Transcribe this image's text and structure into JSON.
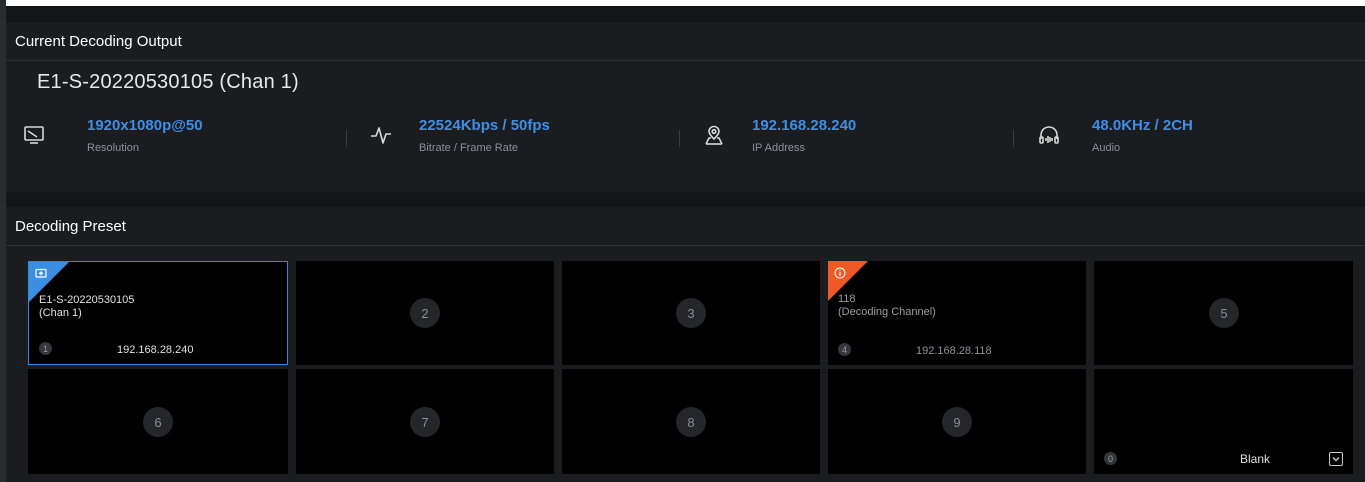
{
  "output": {
    "title": "Current Decoding Output",
    "source_name": "E1-S-20220530105 (Chan 1)",
    "stats": [
      {
        "icon": "monitor-icon",
        "value": "1920x1080p@50",
        "label": "Resolution"
      },
      {
        "icon": "waveform-icon",
        "value": "22524Kbps / 50fps",
        "label": "Bitrate / Frame Rate"
      },
      {
        "icon": "location-pin-icon",
        "value": "192.168.28.240",
        "label": "IP Address"
      },
      {
        "icon": "headphones-icon",
        "value": "48.0KHz / 2CH",
        "label": "Audio"
      }
    ]
  },
  "preset": {
    "title": "Decoding Preset",
    "tiles": [
      {
        "number": "1",
        "name_line1": "E1-S-20220530105",
        "name_line2": "(Chan 1)",
        "ip": "192.168.28.240"
      },
      {
        "number": "2"
      },
      {
        "number": "3"
      },
      {
        "number": "4",
        "name_line1": "118",
        "name_line2": "(Decoding Channel)",
        "ip": "192.168.28.118"
      },
      {
        "number": "5"
      },
      {
        "number": "6"
      },
      {
        "number": "7"
      },
      {
        "number": "8"
      },
      {
        "number": "9"
      },
      {
        "number": "0",
        "label": "Blank"
      }
    ]
  },
  "colors": {
    "accent_blue": "#3d8fe6",
    "selected_border": "#2f88e0",
    "warning_orange": "#ef5a24",
    "panel_bg": "#1b1c20",
    "tile_bg": "#000000"
  }
}
